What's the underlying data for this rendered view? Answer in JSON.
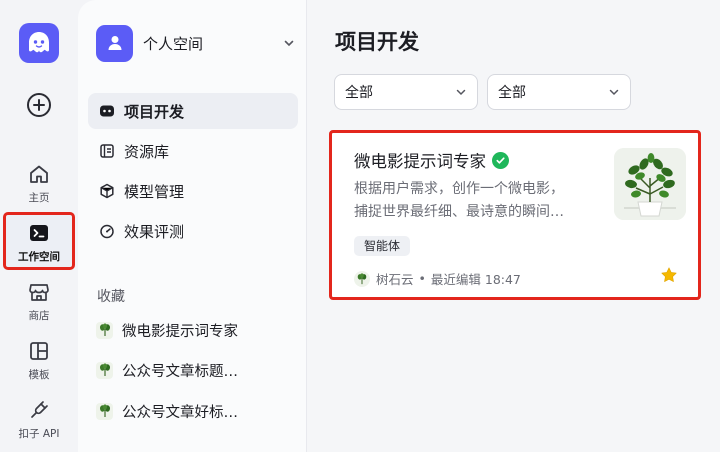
{
  "rail": {
    "logo": "coze-logo-icon",
    "items": [
      {
        "label": "主页",
        "icon": "home-icon"
      },
      {
        "label": "工作空间",
        "icon": "terminal-icon"
      },
      {
        "label": "商店",
        "icon": "store-icon"
      },
      {
        "label": "模板",
        "icon": "template-icon"
      },
      {
        "label": "扣子 API",
        "icon": "plug-icon"
      }
    ]
  },
  "panel": {
    "space_name": "个人空间",
    "nav": [
      {
        "label": "项目开发",
        "icon": "bot-icon"
      },
      {
        "label": "资源库",
        "icon": "library-icon"
      },
      {
        "label": "模型管理",
        "icon": "cube-icon"
      },
      {
        "label": "效果评测",
        "icon": "gauge-icon"
      }
    ],
    "favorites_title": "收藏",
    "favorites": [
      {
        "label": "微电影提示词专家"
      },
      {
        "label": "公众号文章标题…"
      },
      {
        "label": "公众号文章好标…"
      }
    ]
  },
  "main": {
    "title": "项目开发",
    "filters": [
      {
        "value": "全部"
      },
      {
        "value": "全部"
      }
    ],
    "card": {
      "title": "微电影提示词专家",
      "desc_line1": "根据用户需求，创作一个微电影，",
      "desc_line2": "捕捉世界最纤细、最诗意的瞬间…",
      "tag": "智能体",
      "author": "树石云",
      "separator": "•",
      "edited": "最近编辑 18:47"
    }
  },
  "colors": {
    "accent": "#5b5cf6",
    "highlight_border": "#e3261c",
    "verified": "#1fb75a",
    "star": "#f5b800"
  }
}
